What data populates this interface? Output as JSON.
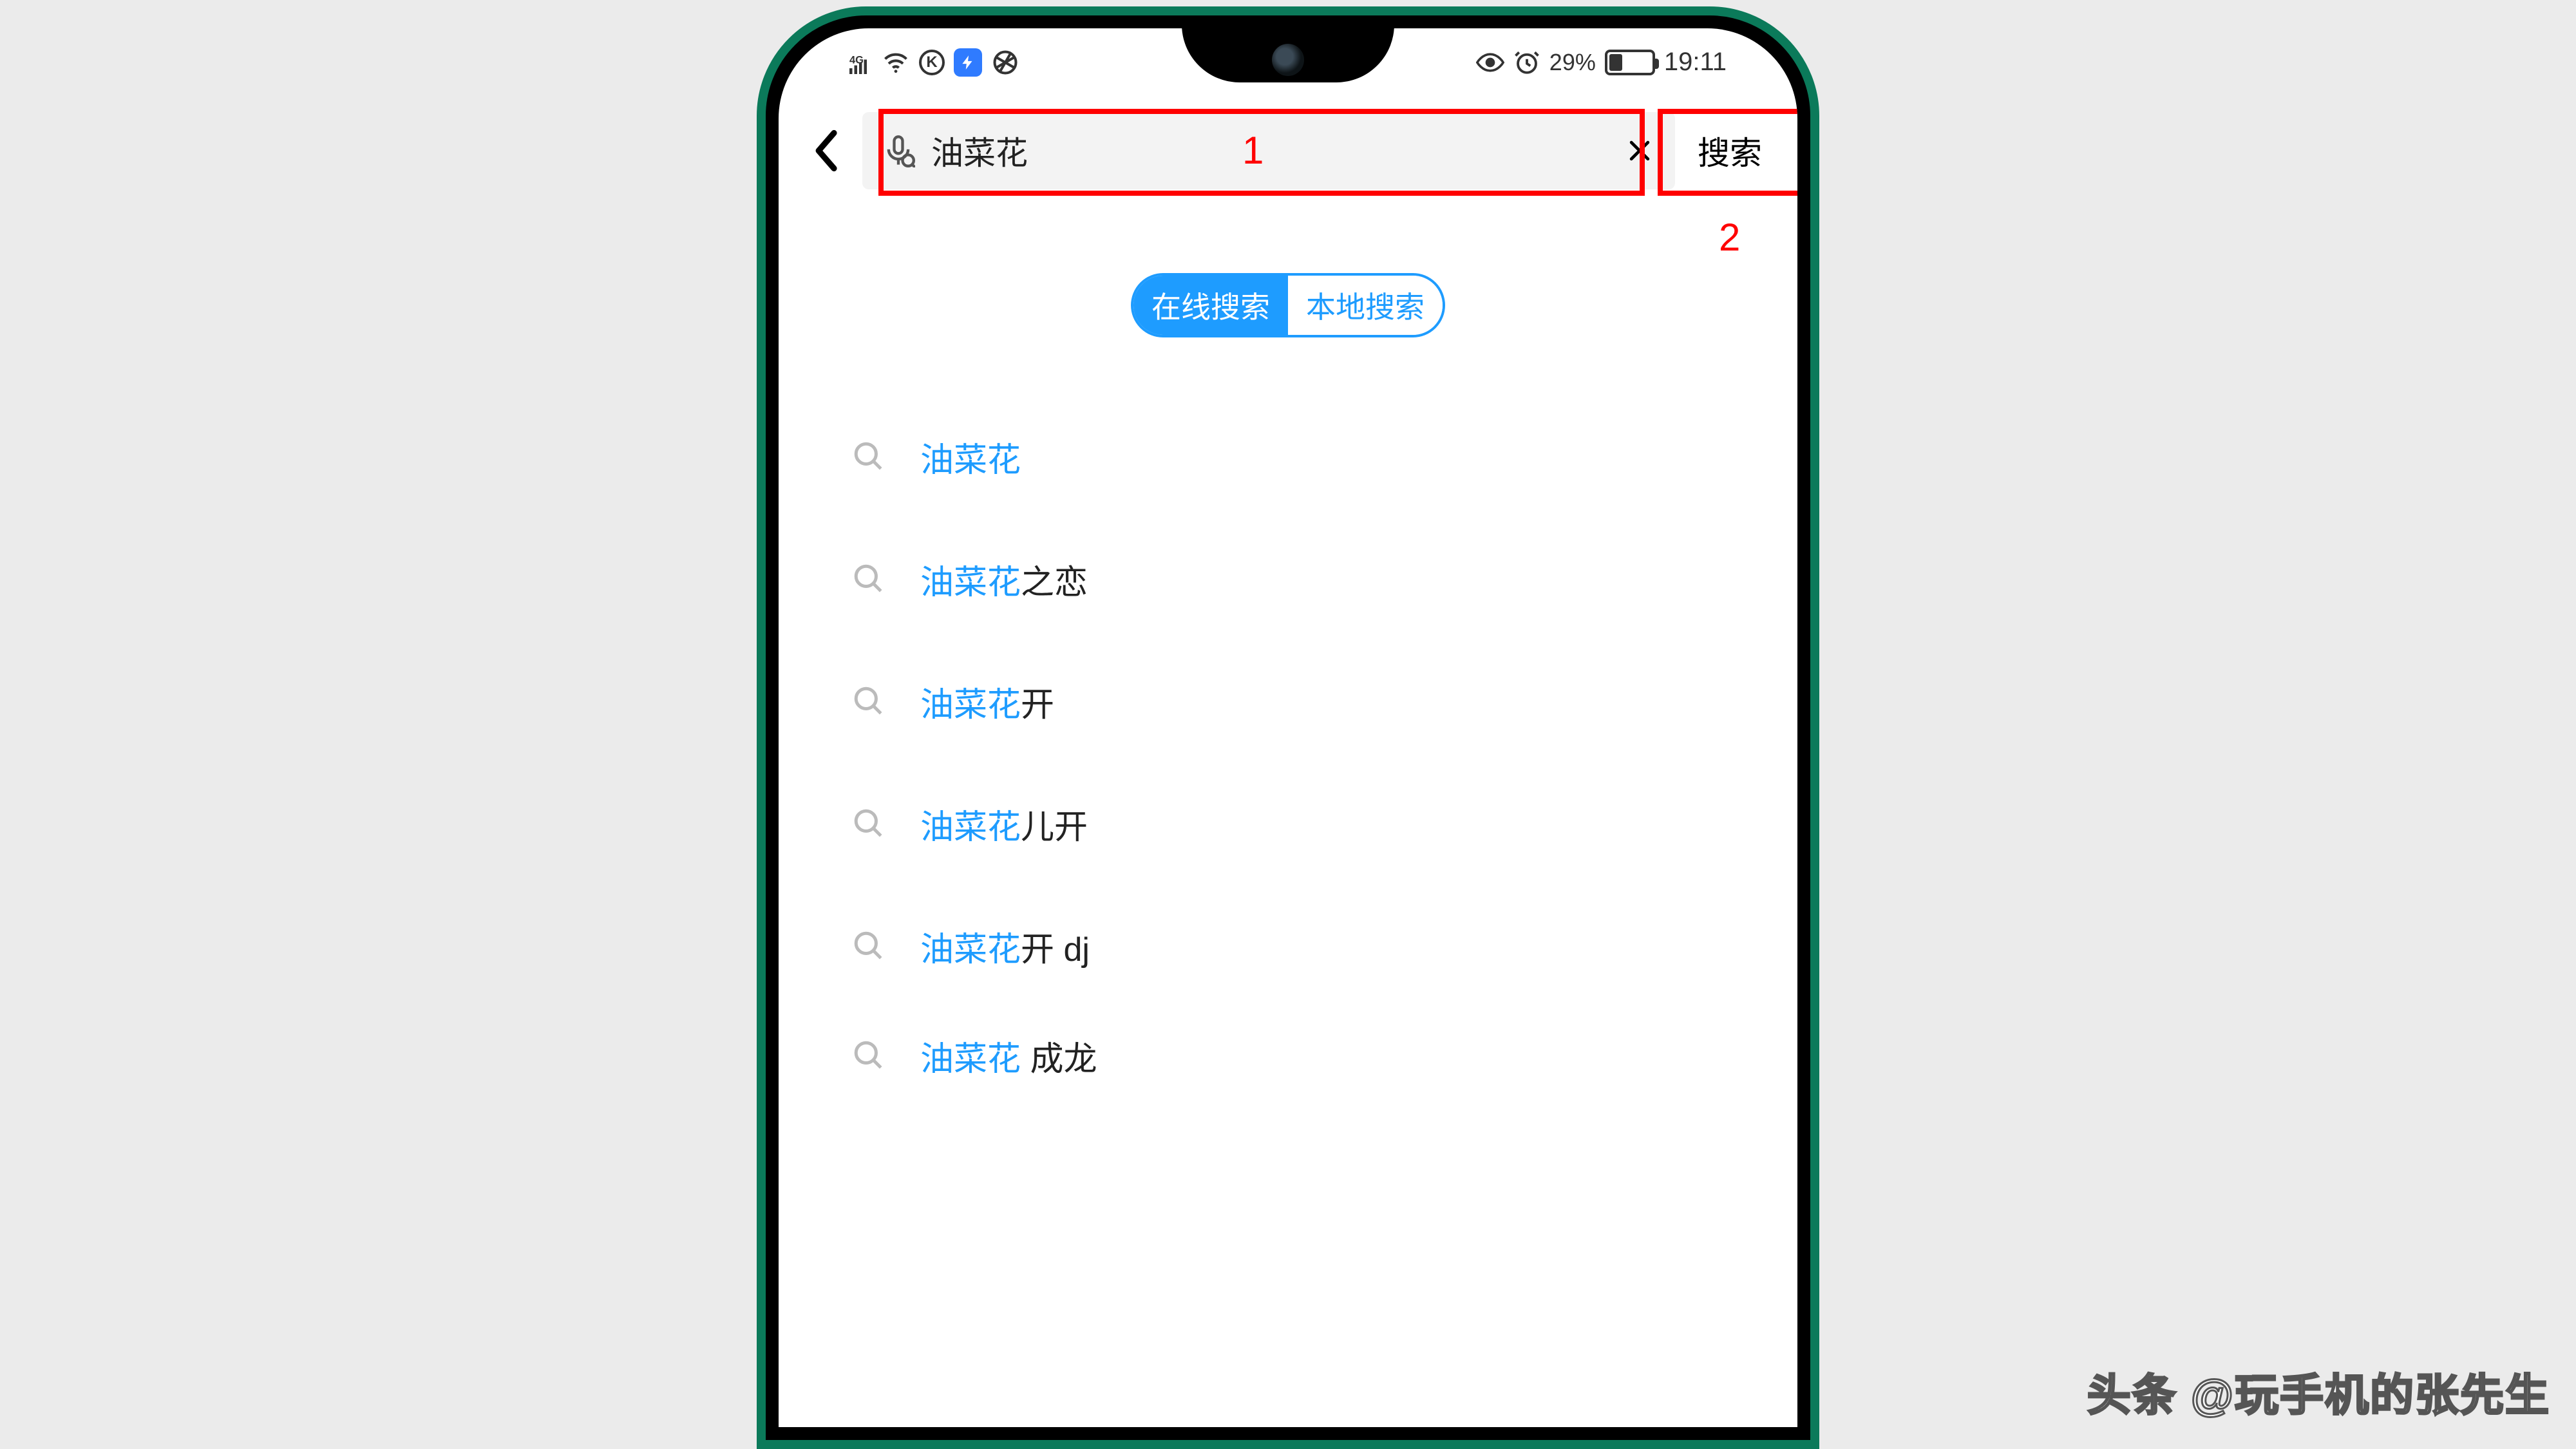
{
  "status": {
    "network_label": "4G",
    "k_label": "K",
    "battery_pct": "29%",
    "time": "19:11"
  },
  "search": {
    "value": "油菜花",
    "button": "搜索"
  },
  "annotations": {
    "hl1": "1",
    "hl2": "2"
  },
  "segmented": {
    "online": "在线搜索",
    "local": "本地搜索"
  },
  "suggestions": [
    {
      "highlight": "油菜花",
      "rest": ""
    },
    {
      "highlight": "油菜花",
      "rest": "之恋"
    },
    {
      "highlight": "油菜花",
      "rest": "开"
    },
    {
      "highlight": "油菜花",
      "rest": "儿开"
    },
    {
      "highlight": "油菜花",
      "rest": "开 dj"
    },
    {
      "highlight": "油菜花",
      "rest": " 成龙"
    }
  ],
  "watermark": "头条 @玩手机的张先生"
}
